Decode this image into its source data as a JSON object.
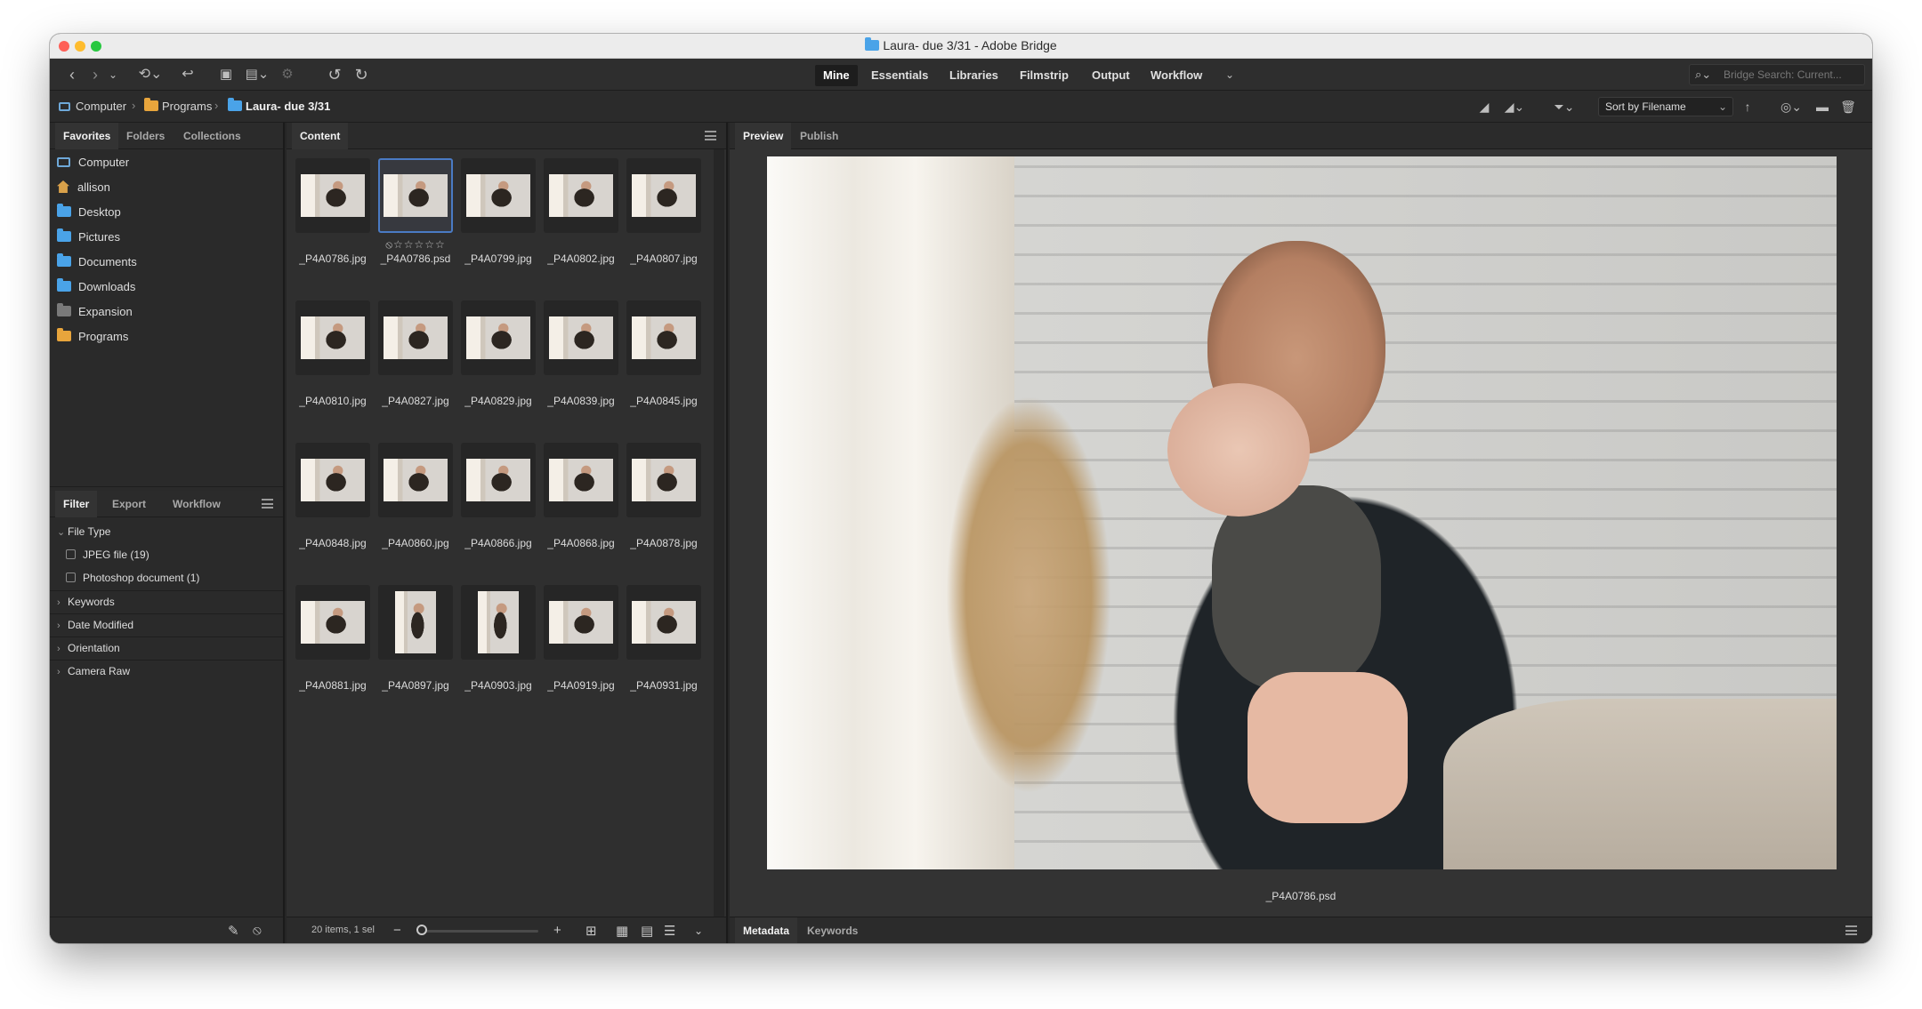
{
  "window": {
    "title": "Laura- due 3/31 - Adobe Bridge"
  },
  "toolbar": {
    "workspaces": [
      "Mine",
      "Essentials",
      "Libraries",
      "Filmstrip",
      "Output",
      "Workflow"
    ],
    "active_workspace": "Mine",
    "search_placeholder": "Bridge Search: Current..."
  },
  "breadcrumb": [
    "Computer",
    "Programs",
    "Laura- due 3/31"
  ],
  "sort": {
    "label": "Sort by Filename"
  },
  "left_panel": {
    "tabs": [
      "Favorites",
      "Folders",
      "Collections"
    ],
    "favorites": [
      "Computer",
      "allison",
      "Desktop",
      "Pictures",
      "Documents",
      "Downloads",
      "Expansion",
      "Programs"
    ]
  },
  "filter_panel": {
    "tabs": [
      "Filter",
      "Export",
      "Workflow"
    ],
    "file_type_label": "File Type",
    "file_types": [
      {
        "label": "JPEG file",
        "count": "(19)"
      },
      {
        "label": "Photoshop document",
        "count": "(1)"
      }
    ],
    "sections": [
      "Keywords",
      "Date Modified",
      "Orientation",
      "Camera Raw"
    ]
  },
  "content_panel": {
    "tab": "Content",
    "files": [
      "_P4A0786.jpg",
      "_P4A0786.psd",
      "_P4A0799.jpg",
      "_P4A0802.jpg",
      "_P4A0807.jpg",
      "_P4A0810.jpg",
      "_P4A0827.jpg",
      "_P4A0829.jpg",
      "_P4A0839.jpg",
      "_P4A0845.jpg",
      "_P4A0848.jpg",
      "_P4A0860.jpg",
      "_P4A0866.jpg",
      "_P4A0868.jpg",
      "_P4A0878.jpg",
      "_P4A0881.jpg",
      "_P4A0897.jpg",
      "_P4A0903.jpg",
      "_P4A0919.jpg",
      "_P4A0931.jpg"
    ],
    "selected_rating": "⦸☆☆☆☆☆",
    "status": "20 items, 1 sel"
  },
  "preview_panel": {
    "tabs": [
      "Preview",
      "Publish"
    ],
    "caption": "_P4A0786.psd",
    "bottom_tabs": [
      "Metadata",
      "Keywords"
    ]
  }
}
